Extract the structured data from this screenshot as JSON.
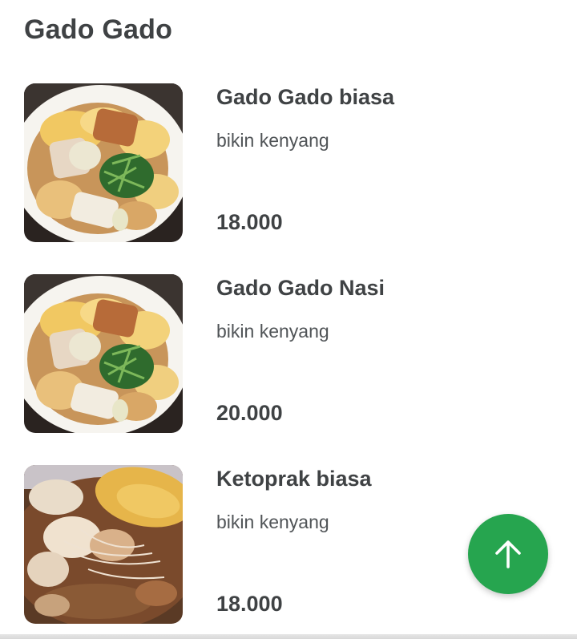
{
  "section": {
    "title": "Gado Gado"
  },
  "menu": {
    "items": [
      {
        "name": "Gado Gado biasa",
        "description": "bikin kenyang",
        "price": "18.000",
        "image_icon": "gado-gado-photo"
      },
      {
        "name": "Gado Gado Nasi",
        "description": "bikin kenyang",
        "price": "20.000",
        "image_icon": "gado-gado-photo"
      },
      {
        "name": "Ketoprak biasa",
        "description": "bikin kenyang",
        "price": "18.000",
        "image_icon": "ketoprak-photo"
      }
    ]
  },
  "fab": {
    "icon": "arrow-up-icon",
    "color": "#26a54f"
  }
}
